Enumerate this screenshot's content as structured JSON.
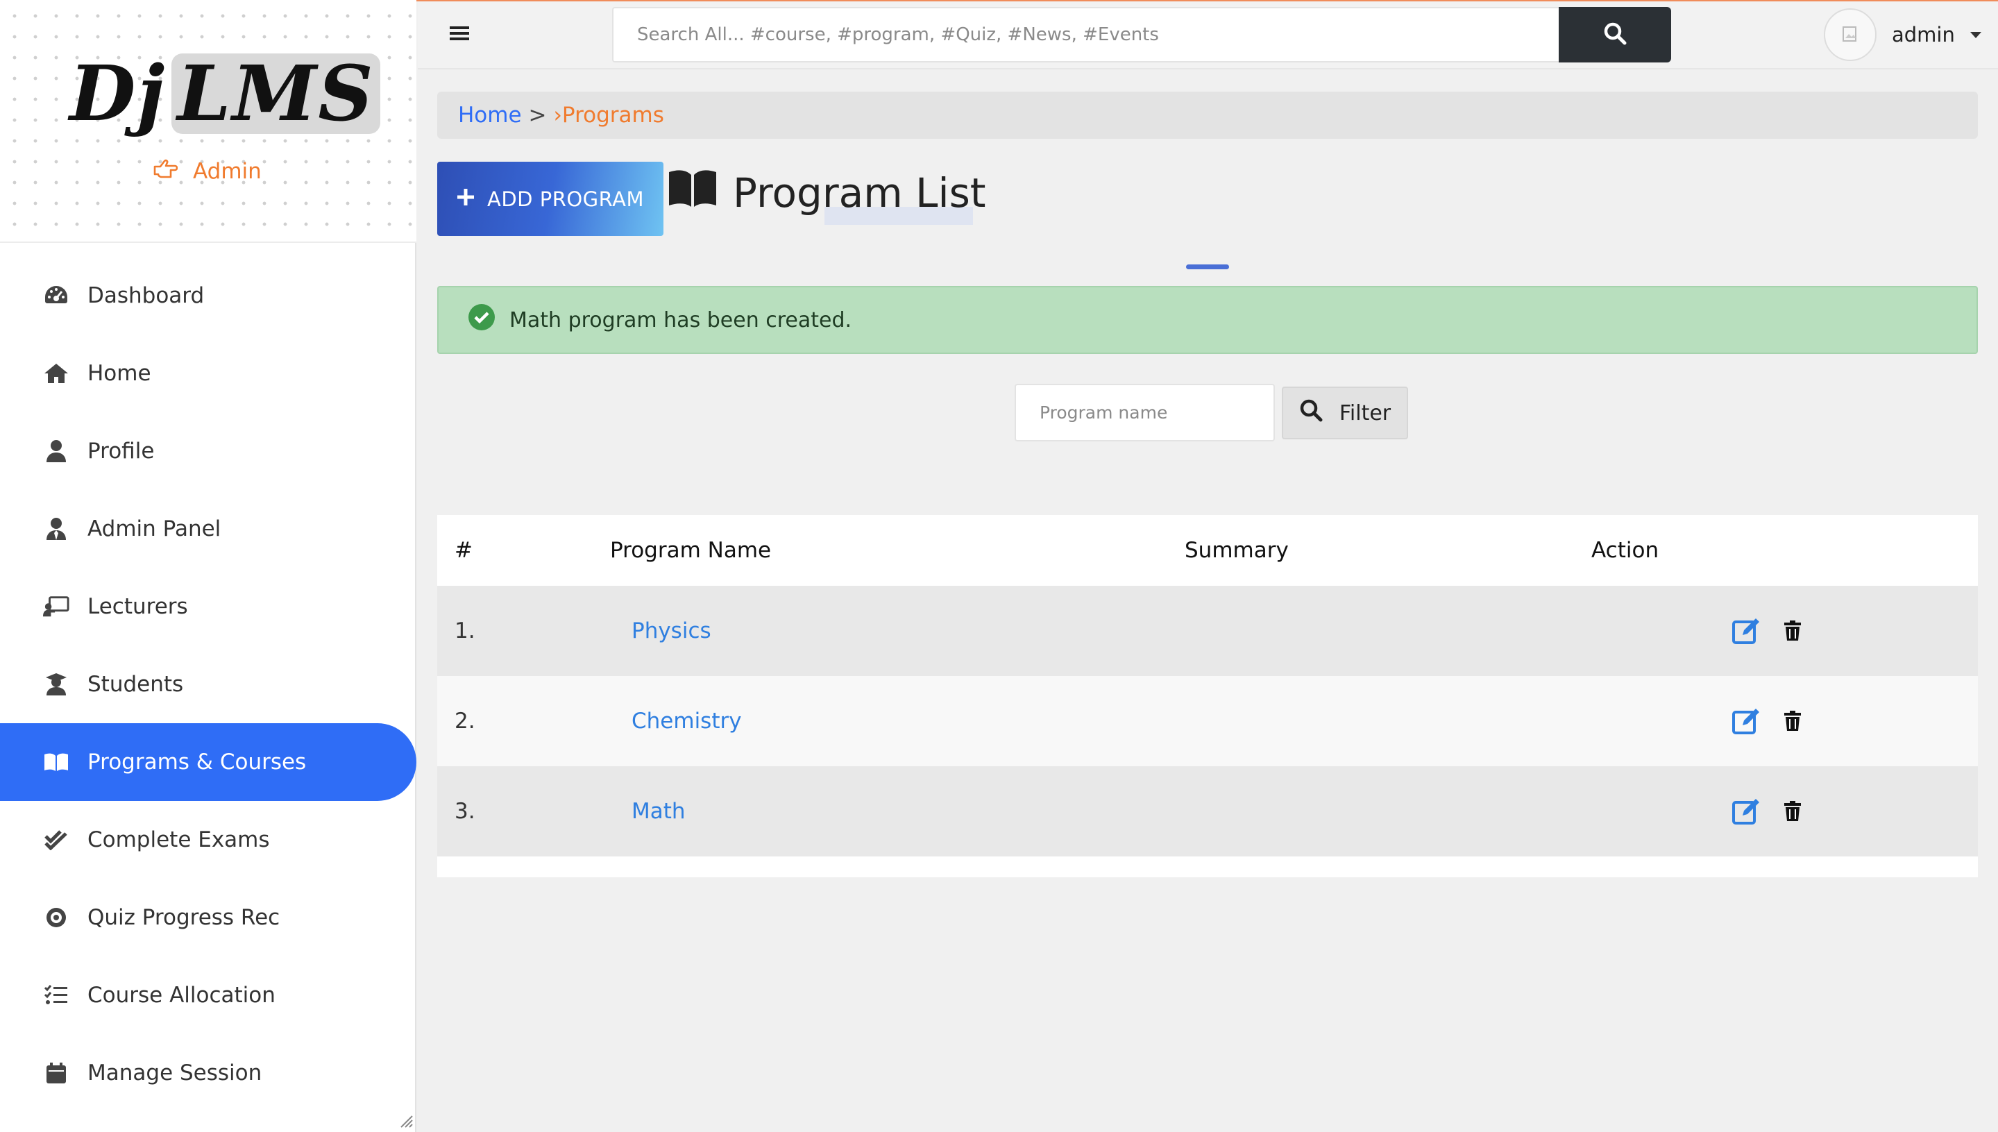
{
  "brand": {
    "logo_part1": "Dj",
    "logo_part2": "LMS",
    "role_label": "Admin",
    "accent": "#f07b2e"
  },
  "sidebar": {
    "items": [
      {
        "label": "Dashboard",
        "icon": "dashboard-gauge-icon",
        "active": false
      },
      {
        "label": "Home",
        "icon": "home-icon",
        "active": false
      },
      {
        "label": "Profile",
        "icon": "user-icon",
        "active": false
      },
      {
        "label": "Admin Panel",
        "icon": "user-tie-icon",
        "active": false
      },
      {
        "label": "Lecturers",
        "icon": "chalkboard-teacher-icon",
        "active": false
      },
      {
        "label": "Students",
        "icon": "user-graduate-icon",
        "active": false
      },
      {
        "label": "Programs & Courses",
        "icon": "book-open-icon",
        "active": true
      },
      {
        "label": "Complete Exams",
        "icon": "check-double-icon",
        "active": false
      },
      {
        "label": "Quiz Progress Rec",
        "icon": "record-icon",
        "active": false
      },
      {
        "label": "Course Allocation",
        "icon": "tasks-list-icon",
        "active": false
      },
      {
        "label": "Manage Session",
        "icon": "calendar-icon",
        "active": false
      }
    ],
    "active_color": "#2f6df6"
  },
  "topbar": {
    "search_placeholder": "Search All... #course, #program, #Quiz, #News, #Events",
    "user_name": "admin"
  },
  "breadcrumb": {
    "home": "Home",
    "separator": ">",
    "current": "›Programs"
  },
  "page": {
    "add_button": "ADD PROGRAM",
    "title": "Program List"
  },
  "alert": {
    "message": "Math program has been created.",
    "color": "#b8dfbe"
  },
  "filter": {
    "placeholder": "Program name",
    "button": "Filter"
  },
  "table": {
    "headers": [
      "#",
      "Program Name",
      "Summary",
      "Action"
    ],
    "rows": [
      {
        "index": "1.",
        "name": "Physics",
        "summary": ""
      },
      {
        "index": "2.",
        "name": "Chemistry",
        "summary": ""
      },
      {
        "index": "3.",
        "name": "Math",
        "summary": ""
      }
    ],
    "link_color": "#2f7fe0"
  }
}
